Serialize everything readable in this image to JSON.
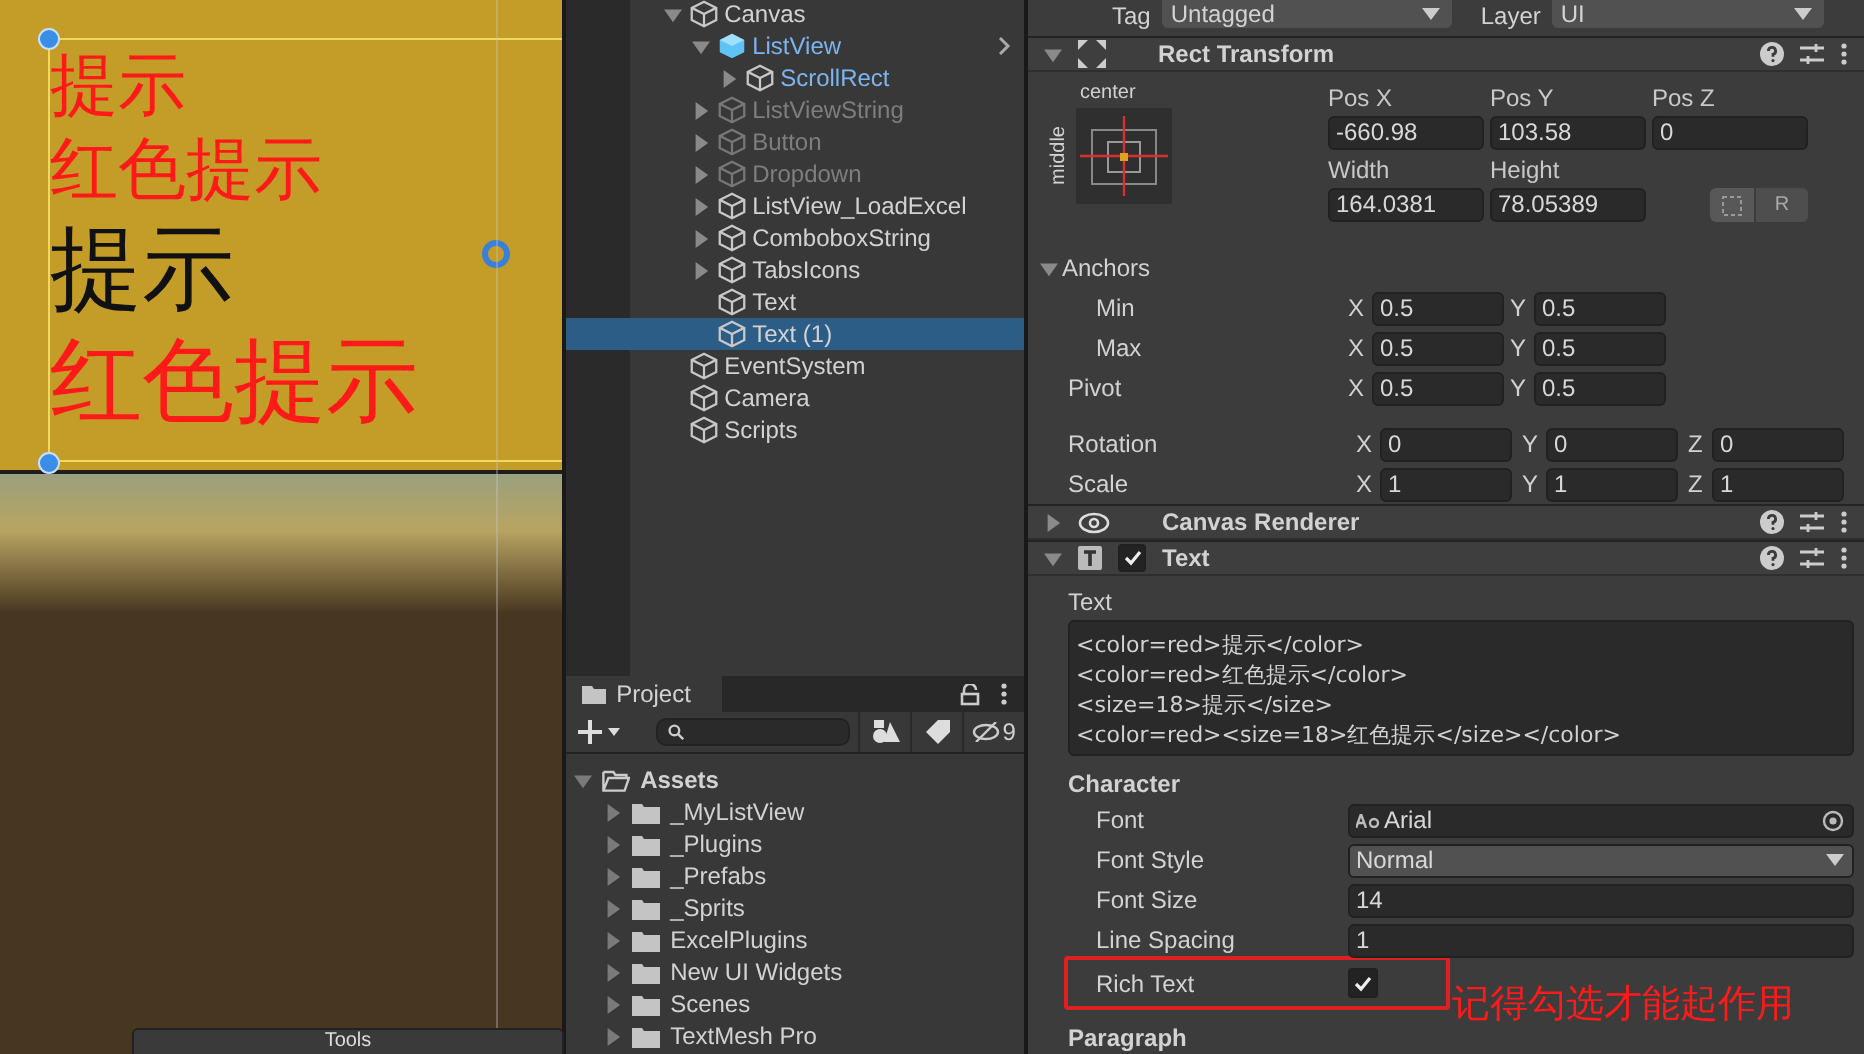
{
  "scene": {
    "text_lines": [
      {
        "text": "提示",
        "color": "#ff1a1a",
        "kind": "small"
      },
      {
        "text": "红色提示",
        "color": "#ff1a1a",
        "kind": "small"
      },
      {
        "text": "提示",
        "color": "#111111",
        "kind": "large"
      },
      {
        "text": "红色提示",
        "color": "#ff1a1a",
        "kind": "large"
      }
    ],
    "bottom_tab": "Tools"
  },
  "hierarchy": {
    "items": [
      {
        "name": "Canvas",
        "kind": "object",
        "expanded": true,
        "disabled": false,
        "selected": false,
        "children": [
          {
            "name": "ListView",
            "kind": "prefab_root",
            "expanded": true,
            "disabled": false,
            "selected": false,
            "children": [
              {
                "name": "ScrollRect",
                "kind": "prefab_child",
                "expanded": false,
                "disabled": false,
                "selected": false,
                "has_children": true
              }
            ]
          },
          {
            "name": "ListViewString",
            "kind": "object",
            "expanded": false,
            "disabled": true,
            "selected": false,
            "has_children": true
          },
          {
            "name": "Button",
            "kind": "object",
            "expanded": false,
            "disabled": true,
            "selected": false,
            "has_children": true
          },
          {
            "name": "Dropdown",
            "kind": "object",
            "expanded": false,
            "disabled": true,
            "selected": false,
            "has_children": true
          },
          {
            "name": "ListView_LoadExcel",
            "kind": "object",
            "expanded": false,
            "disabled": false,
            "selected": false,
            "has_children": true
          },
          {
            "name": "ComboboxString",
            "kind": "object",
            "expanded": false,
            "disabled": false,
            "selected": false,
            "has_children": true
          },
          {
            "name": "TabsIcons",
            "kind": "object",
            "expanded": false,
            "disabled": false,
            "selected": false,
            "has_children": true
          },
          {
            "name": "Text",
            "kind": "object",
            "expanded": false,
            "disabled": false,
            "selected": false,
            "has_children": false
          },
          {
            "name": "Text (1)",
            "kind": "object",
            "expanded": false,
            "disabled": false,
            "selected": true,
            "has_children": false
          }
        ]
      },
      {
        "name": "EventSystem",
        "kind": "object",
        "expanded": false,
        "disabled": false,
        "selected": false,
        "has_children": false
      },
      {
        "name": "Camera",
        "kind": "object",
        "expanded": false,
        "disabled": false,
        "selected": false,
        "has_children": false
      },
      {
        "name": "Scripts",
        "kind": "object",
        "expanded": false,
        "disabled": false,
        "selected": false,
        "has_children": false
      }
    ]
  },
  "project": {
    "tab": "Project",
    "hidden_count": "9",
    "tree": [
      {
        "name": "Assets",
        "expanded": true,
        "children": [
          {
            "name": "_MyListView",
            "expanded": false
          },
          {
            "name": "_Plugins",
            "expanded": false
          },
          {
            "name": "_Prefabs",
            "expanded": false
          },
          {
            "name": "_Sprits",
            "expanded": false
          },
          {
            "name": "ExcelPlugins",
            "expanded": false
          },
          {
            "name": "New UI Widgets",
            "expanded": false
          },
          {
            "name": "Scenes",
            "expanded": false
          },
          {
            "name": "TextMesh Pro",
            "expanded": false
          }
        ]
      }
    ]
  },
  "inspector": {
    "tag": {
      "label": "Tag",
      "value": "Untagged"
    },
    "layer": {
      "label": "Layer",
      "value": "UI"
    },
    "components": [
      {
        "kind": "rect_transform",
        "title": "Rect Transform",
        "expanded": true,
        "anchor_preset": {
          "horizontal": "center",
          "vertical": "middle"
        },
        "position_fields": [
          {
            "label": "Pos X",
            "value": "-660.98"
          },
          {
            "label": "Pos Y",
            "value": "103.58"
          },
          {
            "label": "Pos Z",
            "value": "0"
          }
        ],
        "size_fields": [
          {
            "label": "Width",
            "value": "164.0381"
          },
          {
            "label": "Height",
            "value": "78.05389"
          }
        ],
        "raw_button": "R",
        "anchors": {
          "label": "Anchors",
          "expanded": true,
          "rows": [
            {
              "label": "Min",
              "fields": [
                {
                  "axis": "X",
                  "value": "0.5"
                },
                {
                  "axis": "Y",
                  "value": "0.5"
                }
              ]
            },
            {
              "label": "Max",
              "fields": [
                {
                  "axis": "X",
                  "value": "0.5"
                },
                {
                  "axis": "Y",
                  "value": "0.5"
                }
              ]
            }
          ]
        },
        "rows": [
          {
            "label": "Pivot",
            "fields": [
              {
                "axis": "X",
                "value": "0.5"
              },
              {
                "axis": "Y",
                "value": "0.5"
              }
            ]
          },
          {
            "label": "Rotation",
            "fields": [
              {
                "axis": "X",
                "value": "0"
              },
              {
                "axis": "Y",
                "value": "0"
              },
              {
                "axis": "Z",
                "value": "0"
              }
            ]
          },
          {
            "label": "Scale",
            "fields": [
              {
                "axis": "X",
                "value": "1"
              },
              {
                "axis": "Y",
                "value": "1"
              },
              {
                "axis": "Z",
                "value": "1"
              }
            ]
          }
        ]
      },
      {
        "kind": "canvas_renderer",
        "title": "Canvas Renderer",
        "expanded": false
      },
      {
        "kind": "text",
        "title": "Text",
        "expanded": true,
        "enabled": true,
        "text_label": "Text",
        "text_lines": [
          "<color=red>提示</color>",
          "<color=red>红色提示</color>",
          "<size=18>提示</size>",
          "<color=red><size=18>红色提示</size></color>"
        ],
        "sections": [
          {
            "title": "Character",
            "properties": [
              {
                "kind": "object",
                "label": "Font",
                "value": "Arial",
                "annotated": false
              },
              {
                "kind": "dropdown",
                "label": "Font Style",
                "value": "Normal",
                "annotated": false
              },
              {
                "kind": "number",
                "label": "Font Size",
                "value": "14",
                "annotated": false
              },
              {
                "kind": "number",
                "label": "Line Spacing",
                "value": "1",
                "annotated": false
              },
              {
                "kind": "checkbox",
                "label": "Rich Text",
                "checked": true,
                "annotated": true
              }
            ]
          },
          {
            "title": "Paragraph"
          }
        ]
      }
    ],
    "annotation": "记得勾选才能起作用"
  }
}
